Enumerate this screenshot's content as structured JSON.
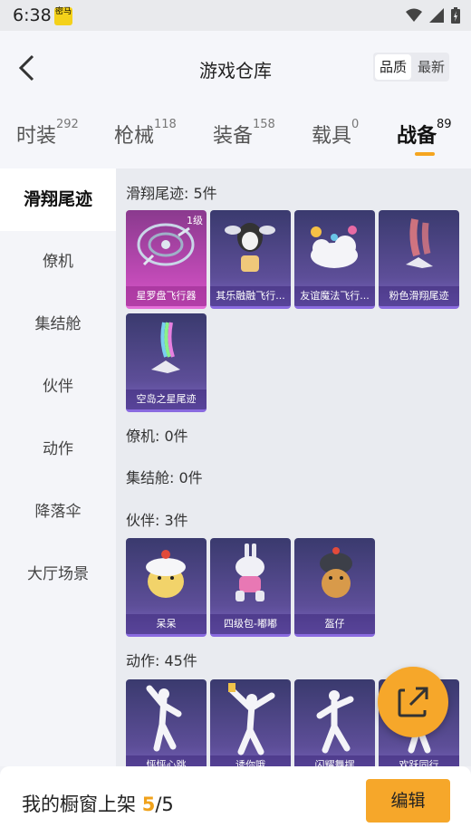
{
  "status_bar": {
    "time": "6:38",
    "app_badge": "密马"
  },
  "header": {
    "title": "游戏仓库",
    "sort": [
      "品质",
      "最新"
    ]
  },
  "tabs": [
    {
      "label": "时装",
      "count": "292"
    },
    {
      "label": "枪械",
      "count": "118"
    },
    {
      "label": "装备",
      "count": "158"
    },
    {
      "label": "载具",
      "count": "0"
    },
    {
      "label": "战备",
      "count": "89"
    }
  ],
  "sidebar": [
    "滑翔尾迹",
    "僚机",
    "集结舱",
    "伙伴",
    "动作",
    "降落伞",
    "大厅场景"
  ],
  "sections": {
    "glide": {
      "title": "滑翔尾迹: 5件",
      "items": [
        {
          "name": "星罗盘飞行器",
          "level": "1级"
        },
        {
          "name": "其乐融融飞行..."
        },
        {
          "name": "友谊魔法飞行..."
        },
        {
          "name": "粉色滑翔尾迹"
        },
        {
          "name": "空岛之星尾迹"
        }
      ]
    },
    "wingman": {
      "title": "僚机: 0件"
    },
    "pod": {
      "title": "集结舱: 0件"
    },
    "partner": {
      "title": "伙伴: 3件",
      "items": [
        {
          "name": "呆呆"
        },
        {
          "name": "四级包-嘟嘟"
        },
        {
          "name": "盔仔"
        }
      ]
    },
    "emote": {
      "title": "动作: 45件",
      "items": [
        {
          "name": "怦怦心跳"
        },
        {
          "name": "诱你哦"
        },
        {
          "name": "闪耀舞摆"
        },
        {
          "name": "欢跃同行"
        }
      ]
    }
  },
  "bottom": {
    "label": "我的橱窗上架",
    "current": "5",
    "sep": "/",
    "total": "5",
    "edit": "编辑"
  },
  "colors": {
    "accent": "#f6a72a",
    "card_purple": "#5d4e98",
    "card_pink": "#c04ab6"
  }
}
